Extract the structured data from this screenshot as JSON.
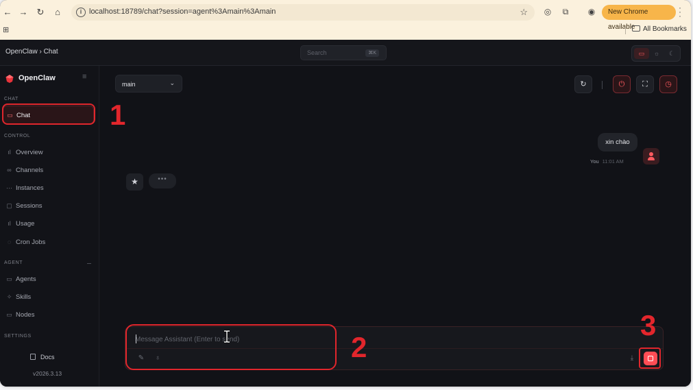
{
  "browser": {
    "url": "localhost:18789/chat?session=agent%3Amain%3Amain",
    "update_label": "New Chrome available",
    "bookmarks_label": "All Bookmarks"
  },
  "topbar": {
    "breadcrumb": "OpenClaw › Chat",
    "search_placeholder": "Search",
    "search_shortcut": "⌘K"
  },
  "sidebar": {
    "brand": "OpenClaw",
    "sections": {
      "chat": "CHAT",
      "control": "CONTROL",
      "agent": "AGENT",
      "settings": "SETTINGS"
    },
    "items": [
      {
        "label": "Chat",
        "icon": "chat-bubble-icon",
        "active": true
      },
      {
        "label": "Overview",
        "icon": "bar-chart-icon"
      },
      {
        "label": "Channels",
        "icon": "link-icon"
      },
      {
        "label": "Instances",
        "icon": "signal-icon"
      },
      {
        "label": "Sessions",
        "icon": "document-icon"
      },
      {
        "label": "Usage",
        "icon": "bar-chart-icon"
      },
      {
        "label": "Cron Jobs",
        "icon": "clock-icon"
      },
      {
        "label": "Agents",
        "icon": "folder-icon"
      },
      {
        "label": "Skills",
        "icon": "sparkle-icon"
      },
      {
        "label": "Nodes",
        "icon": "monitor-icon"
      }
    ],
    "docs": "Docs",
    "version": "v2026.3.13"
  },
  "main": {
    "session_value": "main",
    "messages": [
      {
        "role": "user",
        "text": "xin chào",
        "author": "You",
        "time": "11:01 AM"
      }
    ],
    "composer": {
      "placeholder": "Message Assistant (Enter to send)"
    }
  },
  "annotations": [
    "1",
    "2",
    "3"
  ],
  "colors": {
    "accent": "#ff4d55",
    "annotation": "#e2262c",
    "chrome_bar": "#fbf1dd",
    "update_pill": "#f7b54a",
    "app_background": "#111217"
  }
}
